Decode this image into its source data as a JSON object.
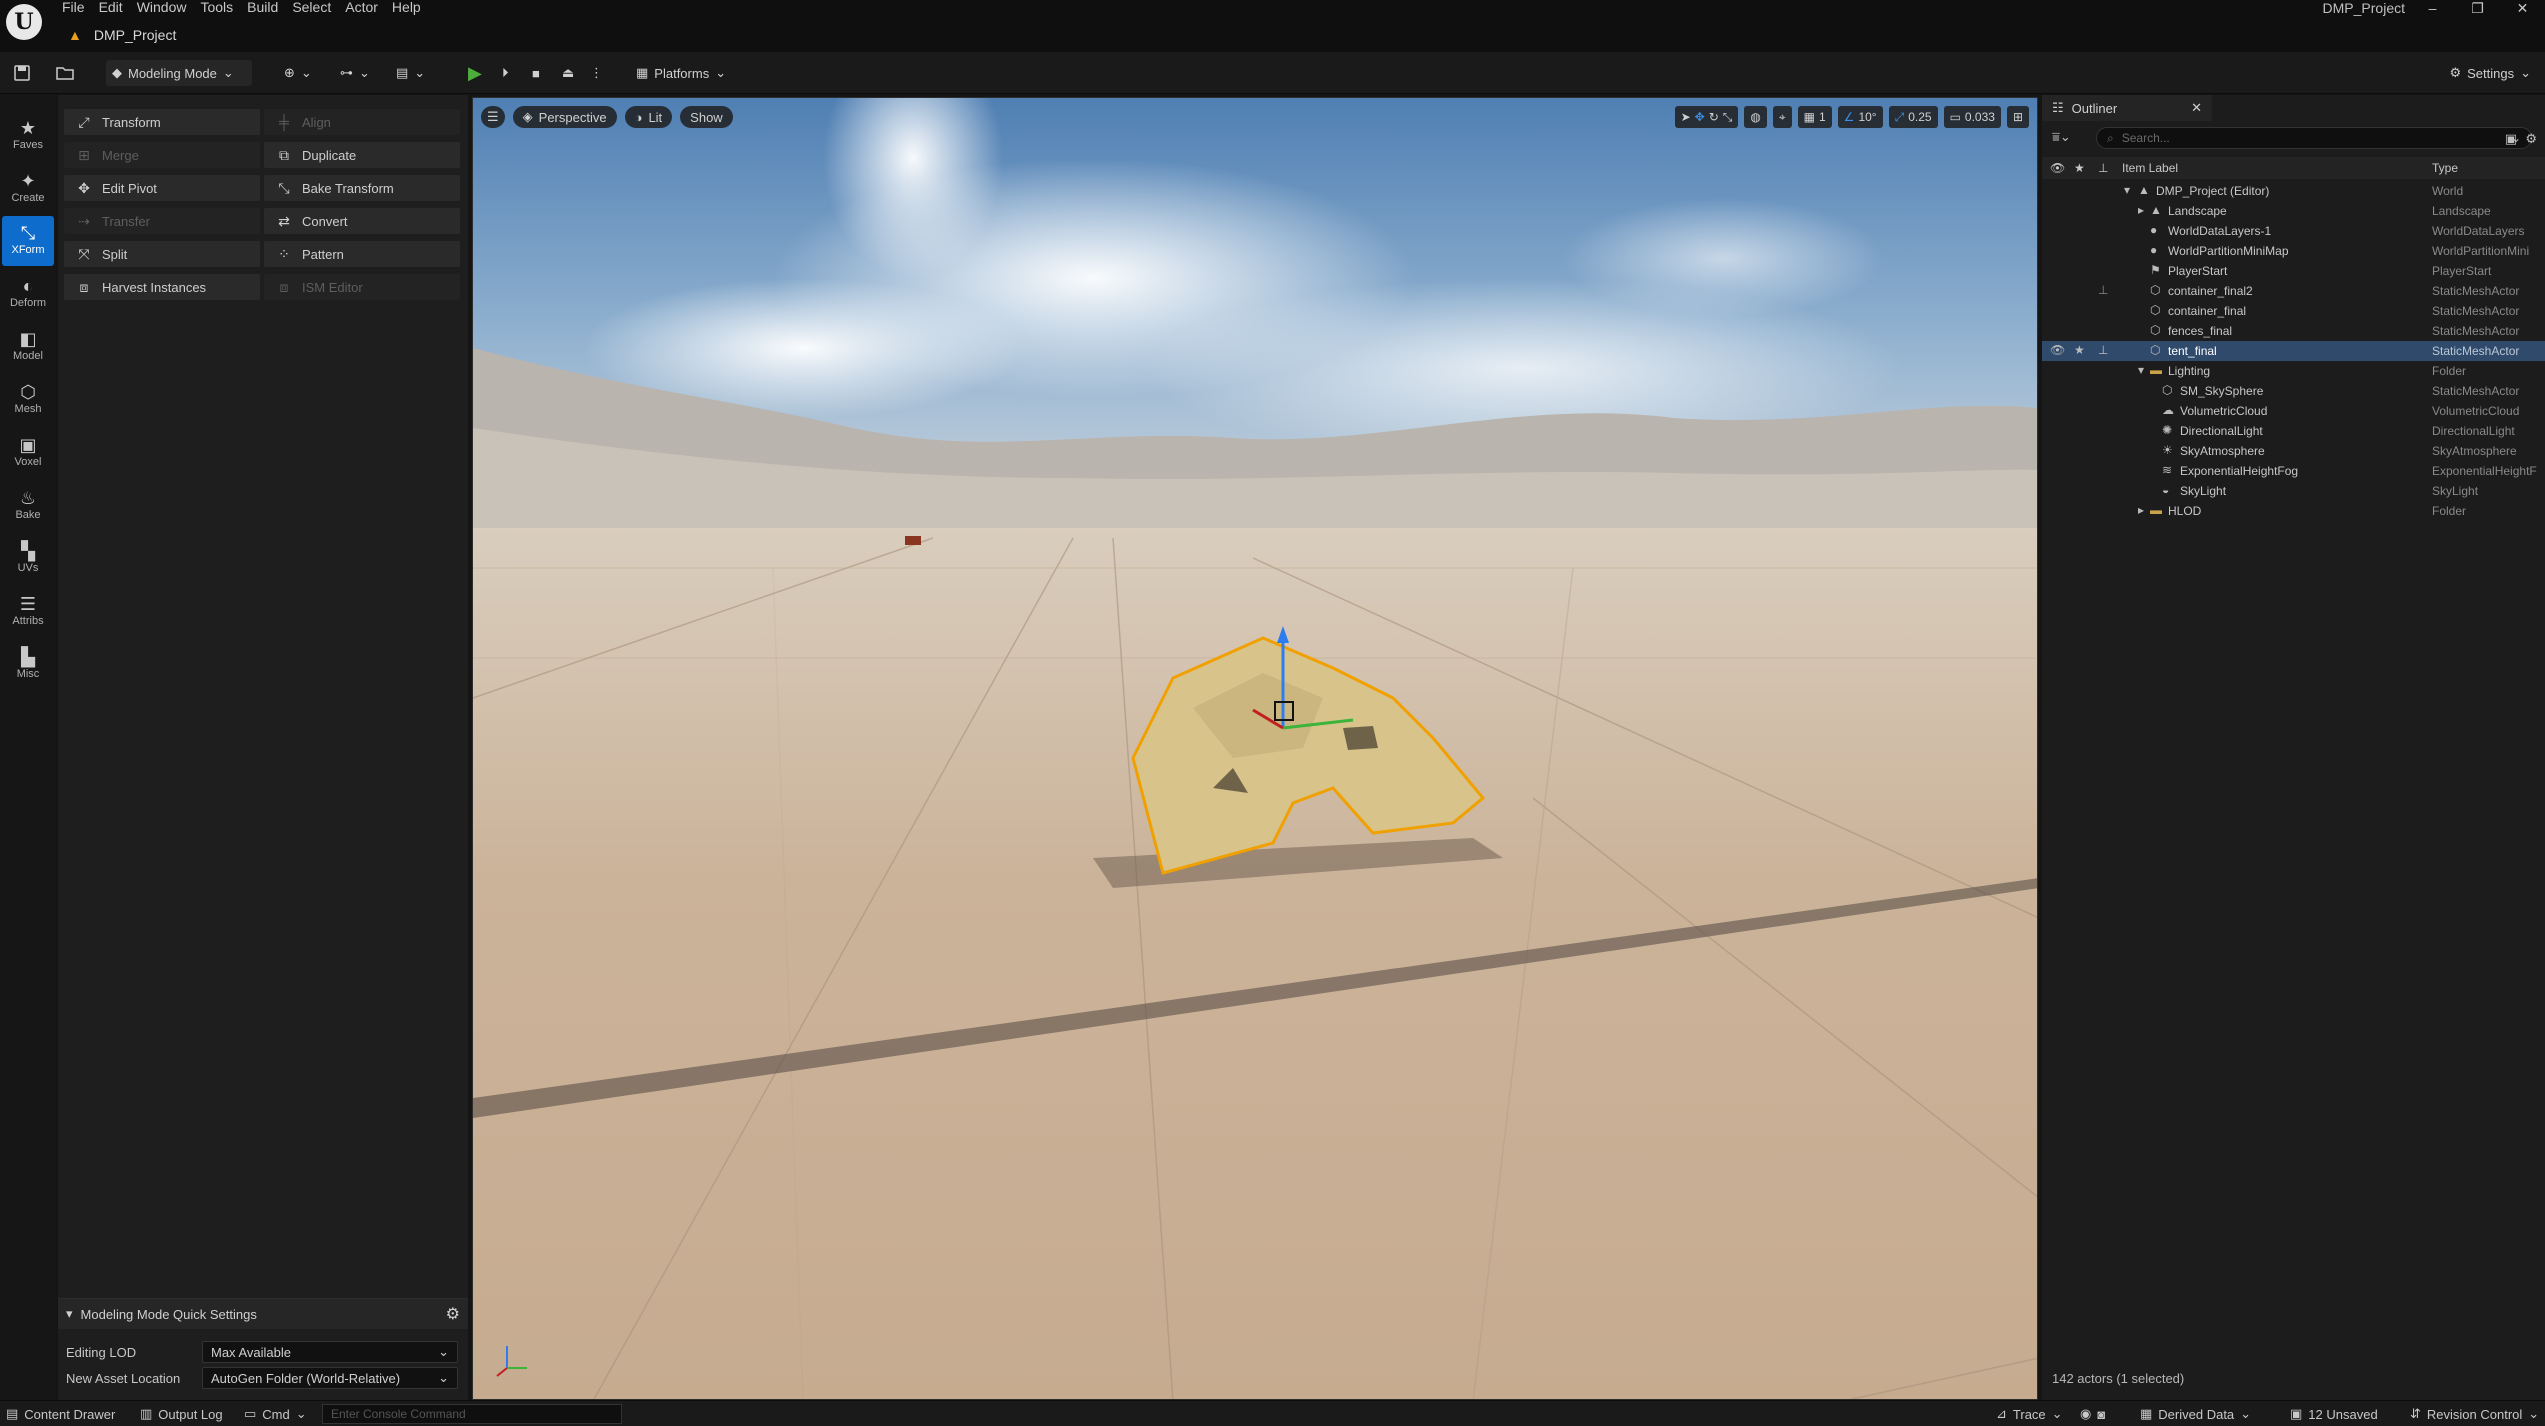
{
  "titlebar": {
    "menu": [
      "File",
      "Edit",
      "Window",
      "Tools",
      "Build",
      "Select",
      "Actor",
      "Help"
    ],
    "project_tab": "DMP_Project",
    "window_title": "DMP_Project"
  },
  "toolbar": {
    "mode_label": "Modeling Mode",
    "platforms_label": "Platforms",
    "settings_label": "Settings"
  },
  "modes": [
    {
      "label": "Faves",
      "icon": "star-icon"
    },
    {
      "label": "Create",
      "icon": "create-icon"
    },
    {
      "label": "XForm",
      "icon": "xform-icon",
      "active": true
    },
    {
      "label": "Deform",
      "icon": "deform-icon"
    },
    {
      "label": "Model",
      "icon": "model-icon"
    },
    {
      "label": "Mesh",
      "icon": "mesh-icon"
    },
    {
      "label": "Voxel",
      "icon": "voxel-icon"
    },
    {
      "label": "Bake",
      "icon": "bake-icon"
    },
    {
      "label": "UVs",
      "icon": "uvs-icon"
    },
    {
      "label": "Attribs",
      "icon": "attribs-icon"
    },
    {
      "label": "Misc",
      "icon": "misc-icon"
    }
  ],
  "tools": [
    {
      "label": "Transform",
      "enabled": true
    },
    {
      "label": "Align",
      "enabled": false
    },
    {
      "label": "Merge",
      "enabled": false
    },
    {
      "label": "Duplicate",
      "enabled": true
    },
    {
      "label": "Edit Pivot",
      "enabled": true
    },
    {
      "label": "Bake Transform",
      "enabled": true
    },
    {
      "label": "Transfer",
      "enabled": false
    },
    {
      "label": "Convert",
      "enabled": true
    },
    {
      "label": "Split",
      "enabled": true
    },
    {
      "label": "Pattern",
      "enabled": true
    },
    {
      "label": "Harvest Instances",
      "enabled": true
    },
    {
      "label": "ISM Editor",
      "enabled": false
    }
  ],
  "quick_settings": {
    "title": "Modeling Mode Quick Settings",
    "editing_lod_label": "Editing LOD",
    "editing_lod_value": "Max Available",
    "asset_location_label": "New Asset Location",
    "asset_location_value": "AutoGen Folder (World-Relative)"
  },
  "viewport": {
    "perspective_label": "Perspective",
    "lit_label": "Lit",
    "show_label": "Show",
    "grid_snap": "1",
    "rotation_snap": "10°",
    "scale_snap": "0.25",
    "camera_speed": "0.033"
  },
  "outliner": {
    "tab_label": "Outliner",
    "search_placeholder": "Search...",
    "col_label": "Item Label",
    "col_type": "Type",
    "rows": [
      {
        "label": "DMP_Project (Editor)",
        "type": "World",
        "depth": 0
      },
      {
        "label": "Landscape",
        "type": "Landscape",
        "depth": 1
      },
      {
        "label": "WorldDataLayers-1",
        "type": "WorldDataLayers",
        "depth": 1
      },
      {
        "label": "WorldPartitionMiniMap",
        "type": "WorldPartitionMini",
        "depth": 1
      },
      {
        "label": "PlayerStart",
        "type": "PlayerStart",
        "depth": 1
      },
      {
        "label": "container_final2",
        "type": "StaticMeshActor",
        "depth": 1
      },
      {
        "label": "container_final",
        "type": "StaticMeshActor",
        "depth": 1
      },
      {
        "label": "fences_final",
        "type": "StaticMeshActor",
        "depth": 1
      },
      {
        "label": "tent_final",
        "type": "StaticMeshActor",
        "depth": 1,
        "selected": true
      },
      {
        "label": "Lighting",
        "type": "Folder",
        "depth": 1
      },
      {
        "label": "SM_SkySphere",
        "type": "StaticMeshActor",
        "depth": 2
      },
      {
        "label": "VolumetricCloud",
        "type": "VolumetricCloud",
        "depth": 2
      },
      {
        "label": "DirectionalLight",
        "type": "DirectionalLight",
        "depth": 2
      },
      {
        "label": "SkyAtmosphere",
        "type": "SkyAtmosphere",
        "depth": 2
      },
      {
        "label": "ExponentialHeightFog",
        "type": "ExponentialHeightF",
        "depth": 2
      },
      {
        "label": "SkyLight",
        "type": "SkyLight",
        "depth": 2
      },
      {
        "label": "HLOD",
        "type": "Folder",
        "depth": 1
      }
    ],
    "footer": "142 actors (1 selected)"
  },
  "statusbar": {
    "content_drawer": "Content Drawer",
    "output_log": "Output Log",
    "cmd": "Cmd",
    "console_placeholder": "Enter Console Command",
    "trace": "Trace",
    "derived_data": "Derived Data",
    "unsaved": "12 Unsaved",
    "revision_control": "Revision Control"
  },
  "colors": {
    "accent": "#0e6ccc",
    "play": "#4caf3c",
    "selection": "#f0a000"
  }
}
